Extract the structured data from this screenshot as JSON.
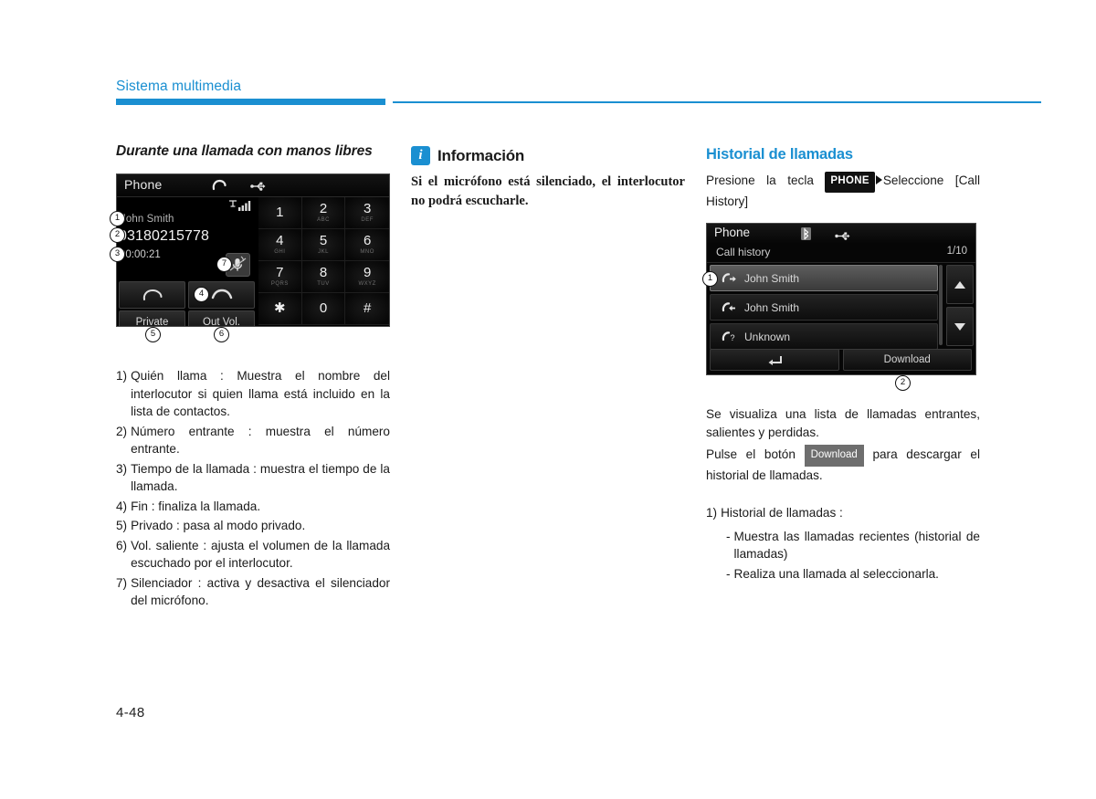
{
  "header": {
    "section_title": "Sistema multimedia",
    "accent_color": "#1a8fd1"
  },
  "footer": {
    "page_number": "4-48"
  },
  "left_column": {
    "heading": "Durante una llamada con manos libres",
    "phone_screen": {
      "status_title": "Phone",
      "icons": [
        "call-handset-icon",
        "usb-icon",
        "signal-bars-icon"
      ],
      "caller_name": "John Smith",
      "phone_number": "03180215778",
      "call_duration": "00:00:21",
      "mute_icon": "mute-microphone-icon",
      "soft_buttons": [
        {
          "name": "answer-call",
          "label": ""
        },
        {
          "name": "end-call",
          "label": ""
        }
      ],
      "soft_buttons_row2": [
        {
          "name": "private",
          "label": "Private"
        },
        {
          "name": "out-volume",
          "label": "Out Vol."
        }
      ],
      "keypad": [
        {
          "num": "1",
          "sub": ""
        },
        {
          "num": "2",
          "sub": "ABC"
        },
        {
          "num": "3",
          "sub": "DEF"
        },
        {
          "num": "4",
          "sub": "GHI"
        },
        {
          "num": "5",
          "sub": "JKL"
        },
        {
          "num": "6",
          "sub": "MNO"
        },
        {
          "num": "7",
          "sub": "PQRS"
        },
        {
          "num": "8",
          "sub": "TUV"
        },
        {
          "num": "9",
          "sub": "WXYZ"
        },
        {
          "num": "✱",
          "sub": ""
        },
        {
          "num": "0",
          "sub": ""
        },
        {
          "num": "#",
          "sub": ""
        }
      ],
      "callouts": [
        "1",
        "2",
        "3",
        "4",
        "5",
        "6",
        "7"
      ]
    },
    "list": [
      {
        "marker": "1)",
        "text": "Quién llama : Muestra el nombre del interlocutor si quien llama está incluido en la lista de contactos."
      },
      {
        "marker": "2)",
        "text": "Número entrante : muestra el número entrante."
      },
      {
        "marker": "3)",
        "text": "Tiempo de la llamada : muestra el tiempo de la llamada."
      },
      {
        "marker": "4)",
        "text": "Fin : finaliza la llamada."
      },
      {
        "marker": "5)",
        "text": "Privado : pasa al modo privado."
      },
      {
        "marker": "6)",
        "text": "Vol. saliente : ajusta el volumen de la llamada escuchado por el interlocutor."
      },
      {
        "marker": "7)",
        "text": "Silenciador : activa y desactiva el silenciador del micrófono."
      }
    ]
  },
  "middle_column": {
    "info_badge": "i",
    "info_title": "Información",
    "info_body": "Si el micrófono está silenciado, el interlocutor no podrá escucharle."
  },
  "right_column": {
    "heading": "Historial de llamadas",
    "instruction_pre": "Presione la tecla",
    "instruction_key": "PHONE",
    "instruction_post": "Seleccione [Call History]",
    "call_history_screen": {
      "status_title": "Phone",
      "icons": [
        "bluetooth-icon",
        "usb-icon"
      ],
      "subtitle": "Call history",
      "page_indicator": "1/10",
      "rows": [
        {
          "icon": "outgoing-call-icon",
          "label": "John Smith",
          "selected": true
        },
        {
          "icon": "incoming-call-icon",
          "label": "John Smith",
          "selected": false
        },
        {
          "icon": "missed-call-icon",
          "label": "Unknown",
          "selected": false
        }
      ],
      "scroll_up": "▲",
      "scroll_down": "▼",
      "bottom_buttons": [
        {
          "name": "back",
          "label": ""
        },
        {
          "name": "download",
          "label": "Download"
        }
      ],
      "callouts": [
        "1",
        "2"
      ]
    },
    "paragraph_1": "Se visualiza una lista de llamadas entrantes, salientes y perdidas.",
    "paragraph_2_pre": "Pulse el botón",
    "paragraph_2_chip": "Download",
    "paragraph_2_post": "para descargar el historial de llamadas.",
    "list": [
      {
        "marker": "1)",
        "text": "Historial de llamadas :"
      }
    ],
    "sublist": [
      {
        "marker": "-",
        "text": "Muestra las llamadas recientes (historial de llamadas)"
      },
      {
        "marker": "-",
        "text": "Realiza una llamada al seleccionarla."
      }
    ]
  }
}
